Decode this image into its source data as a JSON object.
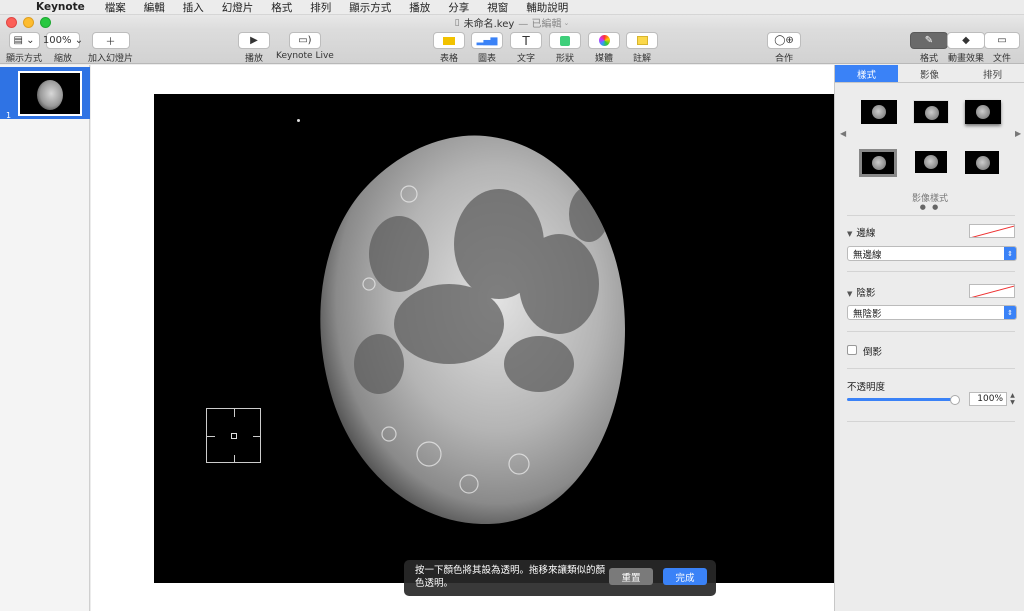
{
  "menubar": {
    "app": "Keynote",
    "items": [
      "檔案",
      "編輯",
      "插入",
      "幻燈片",
      "格式",
      "排列",
      "顯示方式",
      "播放",
      "分享",
      "視窗",
      "輔助說明"
    ]
  },
  "window": {
    "title": "未命名.key",
    "edited": "— 已編輯"
  },
  "toolbar": {
    "view_label": "顯示方式",
    "zoom_value": "100%",
    "zoom_label": "縮放",
    "add_slide_label": "加入幻燈片",
    "play_label": "播放",
    "keynote_live_label": "Keynote Live",
    "table_label": "表格",
    "chart_label": "圖表",
    "text_label": "文字",
    "shape_label": "形狀",
    "media_label": "媒體",
    "comment_label": "註解",
    "collaborate_label": "合作",
    "format_label": "格式",
    "animate_label": "動畫效果",
    "document_label": "文件"
  },
  "navigator": {
    "slide_number": "1"
  },
  "hud": {
    "message": "按一下顏色將其設為透明。拖移來讓類似的顏色透明。",
    "reset_label": "重置",
    "done_label": "完成"
  },
  "inspector": {
    "tabs": [
      "樣式",
      "影像",
      "排列"
    ],
    "image_styles_label": "影像樣式",
    "border_title": "邊線",
    "border_value": "無邊線",
    "shadow_title": "陰影",
    "shadow_value": "無陰影",
    "reflection_label": "倒影",
    "opacity_title": "不透明度",
    "opacity_value": "100%",
    "opacity_fraction": 1.0
  },
  "colors": {
    "accent": "#3a82f7",
    "selection": "#2f73e4"
  }
}
